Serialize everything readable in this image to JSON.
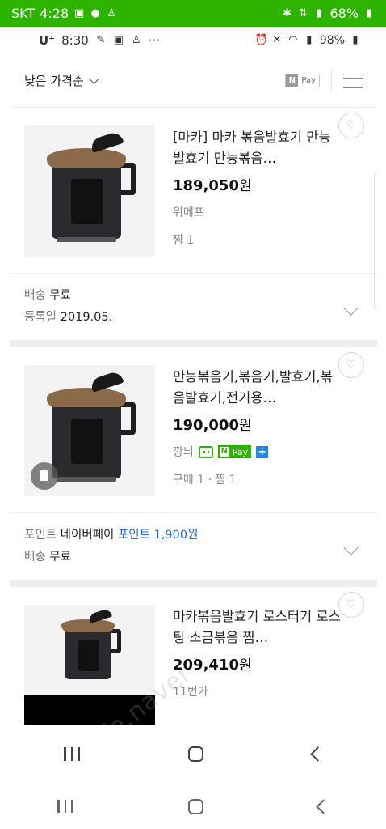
{
  "outer_status": {
    "carrier": "SKT",
    "time": "4:28",
    "battery": "68%",
    "icons_left": [
      "gallery-icon",
      "chat-icon",
      "alert-icon"
    ],
    "icons_right": [
      "bluetooth-icon",
      "lte-icon",
      "signal-icon",
      "battery-icon"
    ]
  },
  "inner_status": {
    "carrier": "U⁺",
    "time": "8:30",
    "more": "···",
    "battery": "98%"
  },
  "sort": {
    "label": "낮은 가격순",
    "npay_n": "N",
    "npay_text": "Pay"
  },
  "products": [
    {
      "title": "[마카] 마카 볶음발효기 만능발효기 만능볶음…",
      "price": "189,050",
      "currency": "원",
      "mall": "위메프",
      "meta": "찜 1",
      "extra": {
        "shipping_label": "배송",
        "shipping_value": "무료",
        "date_label": "등록일",
        "date_value": "2019.05."
      }
    },
    {
      "title": "만능볶음기,볶음기,발효기,볶음발효기,전기용…",
      "price": "190,000",
      "currency": "원",
      "mall": "깡늬",
      "npay_n": "N",
      "npay_text": "Pay",
      "npay_plus": "+",
      "meta": "구매 1 · 찜 1",
      "extra": {
        "point_label": "포인트",
        "point_source": "네이버페이",
        "point_value": "포인트 1,900원",
        "shipping_label": "배송",
        "shipping_value": "무료"
      }
    },
    {
      "title": "마카볶음발효기 로스터기 로스팅 소금볶음 찜…",
      "price": "209,410",
      "currency": "원",
      "mall": "11번가"
    }
  ],
  "watermark": "cafe.naver",
  "colors": {
    "naver_green": "#2db400",
    "link_blue": "#1e6de0"
  }
}
